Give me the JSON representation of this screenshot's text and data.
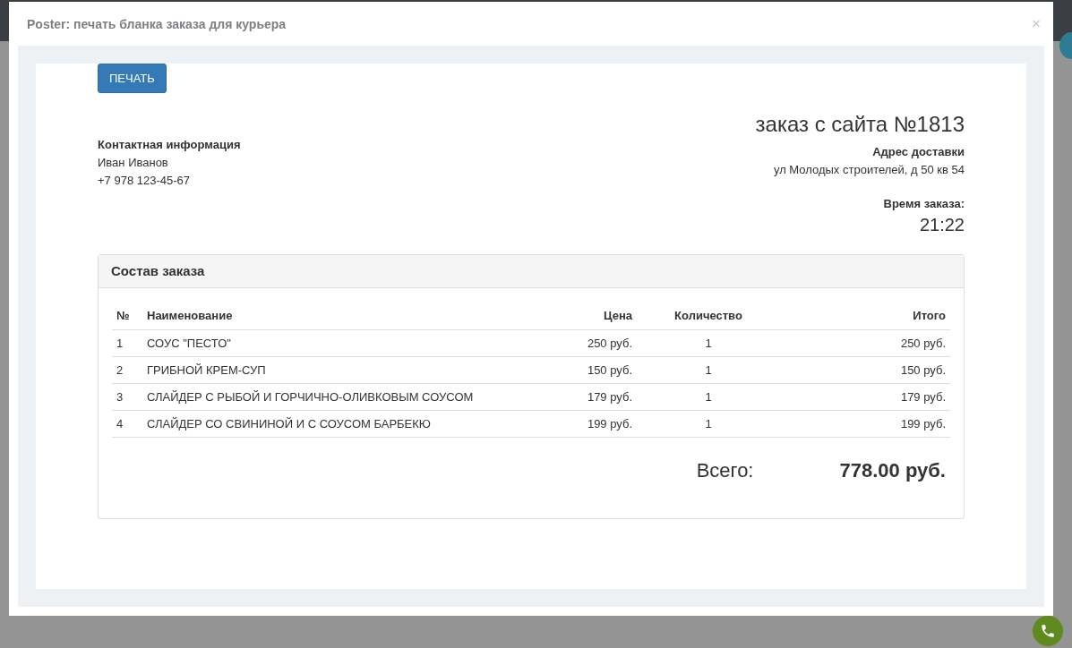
{
  "dialog": {
    "title": "Poster: печать бланка заказа для курьера",
    "close": "×"
  },
  "print_button": "ПЕЧАТЬ",
  "contact": {
    "heading": "Контактная информация",
    "name": "Иван Иванов",
    "phone": "+7 978 123-45-67"
  },
  "order": {
    "title": "заказ с сайта №1813",
    "address_label": "Адрес доставки",
    "address": "ул Молодых строителей, д 50 кв 54",
    "time_label": "Время заказа:",
    "time": "21:22"
  },
  "items_panel": {
    "title": "Состав заказа",
    "columns": [
      "№",
      "Наименование",
      "Цена",
      "Количество",
      "Итого"
    ],
    "rows": [
      {
        "n": "1",
        "name": "СОУС \"ПЕСТО\"",
        "price": "250 руб.",
        "qty": "1",
        "total": "250 руб."
      },
      {
        "n": "2",
        "name": "ГРИБНОЙ КРЕМ-СУП",
        "price": "150 руб.",
        "qty": "1",
        "total": "150 руб."
      },
      {
        "n": "3",
        "name": "СЛАЙДЕР С РЫБОЙ И ГОРЧИЧНО-ОЛИВКОВЫМ СОУСОМ",
        "price": "179 руб.",
        "qty": "1",
        "total": "179 руб."
      },
      {
        "n": "4",
        "name": "СЛАЙДЕР СО СВИНИНОЙ И С СОУСОМ БАРБЕКЮ",
        "price": "199 руб.",
        "qty": "1",
        "total": "199 руб."
      }
    ],
    "total_label": "Всего:",
    "total": "778.00 руб."
  }
}
